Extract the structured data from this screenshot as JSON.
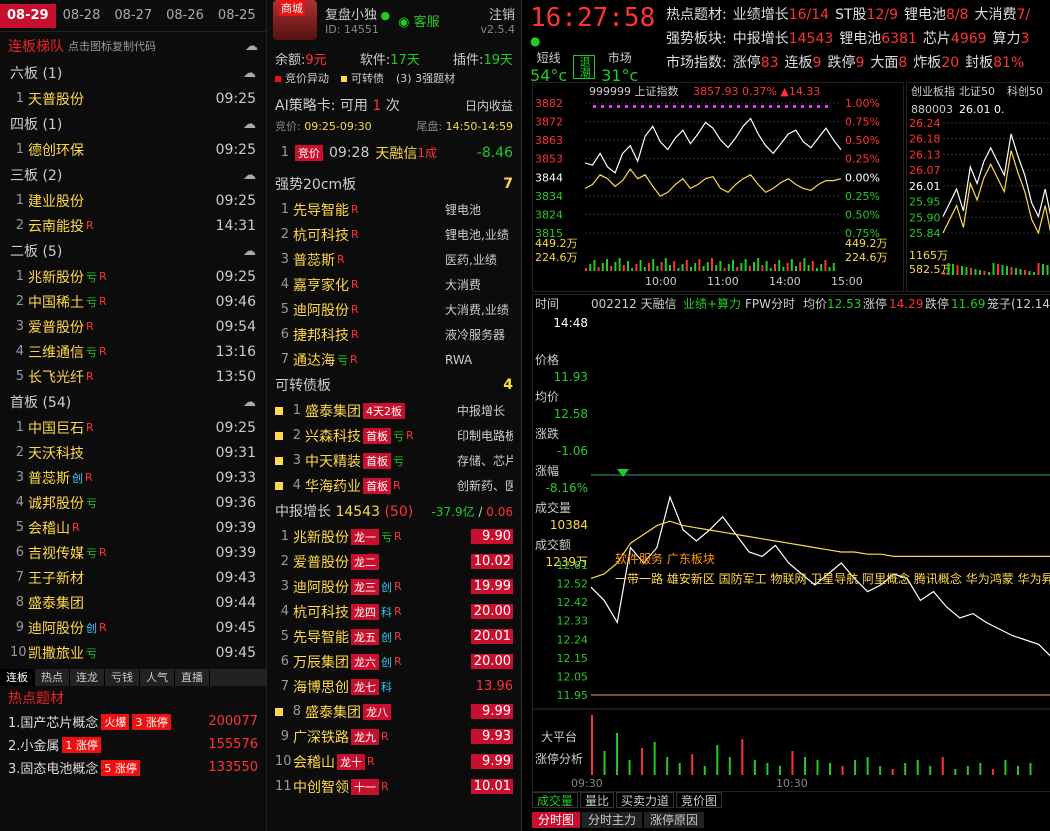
{
  "dates": [
    "08-29",
    "08-28",
    "08-27",
    "08-26",
    "08-25"
  ],
  "ladder": {
    "title": "连板梯队",
    "hint": "点击图标复制代码",
    "groups": [
      {
        "label": "六板 (1)",
        "items": [
          {
            "n": "1",
            "name": "天普股份",
            "tags": [],
            "time": "09:25"
          }
        ]
      },
      {
        "label": "四板 (1)",
        "items": [
          {
            "n": "1",
            "name": "德创环保",
            "tags": [],
            "time": "09:25"
          }
        ]
      },
      {
        "label": "三板 (2)",
        "items": [
          {
            "n": "1",
            "name": "建业股份",
            "tags": [],
            "time": "09:25"
          },
          {
            "n": "2",
            "name": "云南能投",
            "tags": [
              "R"
            ],
            "time": "14:31"
          }
        ]
      },
      {
        "label": "二板 (5)",
        "items": [
          {
            "n": "1",
            "name": "兆新股份",
            "tags": [
              "亏",
              "R"
            ],
            "time": "09:25"
          },
          {
            "n": "2",
            "name": "中国稀土",
            "tags": [
              "亏",
              "R"
            ],
            "time": "09:46"
          },
          {
            "n": "3",
            "name": "爱普股份",
            "tags": [
              "R"
            ],
            "time": "09:54"
          },
          {
            "n": "4",
            "name": "三维通信",
            "tags": [
              "亏",
              "R"
            ],
            "time": "13:16"
          },
          {
            "n": "5",
            "name": "长飞光纤",
            "tags": [
              "R"
            ],
            "time": "13:50"
          }
        ]
      },
      {
        "label": "首板 (54)",
        "items": [
          {
            "n": "1",
            "name": "中国巨石",
            "tags": [
              "R"
            ],
            "time": "09:25"
          },
          {
            "n": "2",
            "name": "天沃科技",
            "tags": [],
            "time": "09:31"
          },
          {
            "n": "3",
            "name": "普蕊斯",
            "tags": [
              "创",
              "R"
            ],
            "time": "09:33"
          },
          {
            "n": "4",
            "name": "诚邦股份",
            "tags": [
              "亏"
            ],
            "time": "09:36"
          },
          {
            "n": "5",
            "name": "会稽山",
            "tags": [
              "R"
            ],
            "time": "09:39"
          },
          {
            "n": "6",
            "name": "吉视传媒",
            "tags": [
              "亏",
              "R"
            ],
            "time": "09:39"
          },
          {
            "n": "7",
            "name": "王子新材",
            "tags": [],
            "time": "09:43"
          },
          {
            "n": "8",
            "name": "盛泰集团",
            "tags": [],
            "time": "09:44"
          },
          {
            "n": "9",
            "name": "迪阿股份",
            "tags": [
              "创",
              "R"
            ],
            "time": "09:45"
          },
          {
            "n": "10",
            "name": "凯撒旅业",
            "tags": [
              "亏"
            ],
            "time": "09:45"
          }
        ]
      }
    ]
  },
  "btabs": [
    "连板",
    "热点",
    "连龙",
    "亏钱",
    "人气",
    "直播"
  ],
  "hot": {
    "title": "热点题材",
    "items": [
      {
        "name": "1.国产芯片概念",
        "badges": [
          "火爆",
          "3 涨停"
        ],
        "v": "200077"
      },
      {
        "name": "2.小金属",
        "badges": [
          "1 涨停"
        ],
        "v": "155576"
      },
      {
        "name": "3.固态电池概念",
        "badges": [
          "5 涨停"
        ],
        "v": "133550"
      }
    ]
  },
  "user": {
    "shop": "商城",
    "name": "复盘小独",
    "id": "ID: 14551",
    "service": "客服",
    "logout": "注销",
    "ver": "v2.5.4"
  },
  "acct": {
    "yue": "余额:",
    "yue_v": "9元",
    "soft": "软件:",
    "soft_v": "17天",
    "plugin": "插件:",
    "plugin_v": "19天"
  },
  "legend": [
    "竞价异动",
    "可转债",
    "(3) 3强题材"
  ],
  "ai": {
    "title": "AI策略卡:",
    "avail": "可用",
    "cnt": "1",
    "unit": "次",
    "right": "日内收益",
    "bid": "竞价:",
    "bid_v": "09:25-09:30",
    "tail": "尾盘:",
    "tail_v": "14:50-14:59"
  },
  "airow": {
    "n": "1",
    "tag": "竞价",
    "time": "09:28",
    "name": "天融信",
    "suffix": "1成",
    "v": "-8.46"
  },
  "strong": {
    "title": "强势20cm板",
    "count": "7",
    "items": [
      {
        "n": "1",
        "name": "先导智能",
        "desc": "锂电池"
      },
      {
        "n": "2",
        "name": "杭可科技",
        "desc": "锂电池,业绩"
      },
      {
        "n": "3",
        "name": "普蕊斯",
        "desc": "医药,业绩"
      },
      {
        "n": "4",
        "name": "嘉亨家化",
        "desc": "大消费"
      },
      {
        "n": "5",
        "name": "迪阿股份",
        "desc": "大消费,业绩"
      },
      {
        "n": "6",
        "name": "捷邦科技",
        "desc": "液冷服务器"
      },
      {
        "n": "7",
        "name": "通达海",
        "desc": "RWA",
        "tag": "亏"
      }
    ]
  },
  "bond": {
    "title": "可转债板",
    "count": "4",
    "items": [
      {
        "n": "1",
        "name": "盛泰集团",
        "box": "4天2板",
        "desc": "中报增长"
      },
      {
        "n": "2",
        "name": "兴森科技",
        "box": "首板",
        "tags": "亏 R",
        "desc": "印制电路板"
      },
      {
        "n": "3",
        "name": "中天精装",
        "box": "首板",
        "tags": "亏",
        "desc": "存储、芯片"
      },
      {
        "n": "4",
        "name": "华海药业",
        "box": "首板",
        "tags": "R",
        "desc": "创新药、医"
      }
    ]
  },
  "growth": {
    "title": "中报增长",
    "num": "14543",
    "cnt": "(50)",
    "amt": "-37.9亿",
    "pct": "0.06",
    "items": [
      {
        "n": "1",
        "name": "兆新股份",
        "box": "龙一",
        "tags": "亏 R",
        "v": "9.90",
        "hl": true
      },
      {
        "n": "2",
        "name": "爱普股份",
        "box": "龙二",
        "tags": "",
        "v": "10.02",
        "hl": true
      },
      {
        "n": "3",
        "name": "迪阿股份",
        "box": "龙三",
        "tags": "创 R",
        "v": "19.99",
        "hl": true
      },
      {
        "n": "4",
        "name": "杭可科技",
        "box": "龙四",
        "tags": "科 R",
        "v": "20.00",
        "hl": true
      },
      {
        "n": "5",
        "name": "先导智能",
        "box": "龙五",
        "tags": "创 R",
        "v": "20.01",
        "hl": true
      },
      {
        "n": "6",
        "name": "万辰集团",
        "box": "龙六",
        "tags": "创 R",
        "v": "20.00",
        "hl": true
      },
      {
        "n": "7",
        "name": "海博思创",
        "box": "龙七",
        "tags": "科",
        "v": "13.96",
        "hl": false
      },
      {
        "n": "8",
        "name": "盛泰集团",
        "box": "龙八",
        "tags": "",
        "v": "9.99",
        "hl": true
      },
      {
        "n": "9",
        "name": "广深铁路",
        "box": "龙九",
        "tags": "R",
        "v": "9.93",
        "hl": true
      },
      {
        "n": "10",
        "name": "会稽山",
        "box": "龙十",
        "tags": "R",
        "v": "9.99",
        "hl": true
      },
      {
        "n": "11",
        "name": "中创智领",
        "box": "十一",
        "tags": "R",
        "v": "10.01",
        "hl": true
      }
    ]
  },
  "clock": {
    "time": "16:27:58",
    "l1": "短线",
    "l2": "退潮",
    "l3": "市场",
    "v1": "54°c",
    "v3": "31°c"
  },
  "stats": {
    "row1": [
      [
        "热点题材:",
        ""
      ],
      [
        "业绩增长",
        "16/14"
      ],
      [
        "ST股",
        "12/9"
      ],
      [
        "锂电池",
        "8/8"
      ],
      [
        "大消费",
        "7/"
      ]
    ],
    "row2": [
      [
        "强势板块:",
        ""
      ],
      [
        "中报增长",
        "14543"
      ],
      [
        "锂电池",
        "6381"
      ],
      [
        "芯片",
        "4969"
      ],
      [
        "算力",
        "3"
      ]
    ],
    "row3": [
      [
        "市场指数:",
        ""
      ],
      [
        "涨停",
        "83"
      ],
      [
        "连板",
        "9"
      ],
      [
        "跌停",
        "9"
      ],
      [
        "大面",
        "8"
      ],
      [
        "炸板",
        "20"
      ],
      [
        "封板",
        "81%"
      ]
    ]
  },
  "index": {
    "code": "999999",
    "name": "上证指数",
    "price": "3857.93",
    "pct": "0.37%",
    "chg": "▲14.33",
    "yl": [
      "3882",
      "3872",
      "3863",
      "3853",
      "3844",
      "3834",
      "3824",
      "3815"
    ],
    "yr": [
      "1.00%",
      "0.75%",
      "0.50%",
      "0.25%",
      "0.00%",
      "0.25%",
      "0.50%",
      "0.75%"
    ],
    "vol1": "449.2万",
    "vol2": "224.6万",
    "xt": [
      "10:00",
      "11:00",
      "14:00",
      "15:00"
    ]
  },
  "gem": {
    "tabs": [
      "创业板指",
      "北证50",
      "科创50"
    ],
    "code": "880003",
    "price": "26.01",
    "v": "0.",
    "yl": [
      "26.24",
      "26.18",
      "26.13",
      "26.07",
      "26.01",
      "25.95",
      "25.90",
      "25.84"
    ],
    "vol1": "1165万",
    "vol2": "582.5万"
  },
  "stock": {
    "tab": "时间",
    "code": "002212",
    "name": "天融信",
    "tags": "业绩+算力",
    "fpw": "FPW分时",
    "avg_l": "均价",
    "avg": "12.53",
    "zt_l": "涨停",
    "zt": "14.29",
    "dt_l": "跌停",
    "dt": "11.69",
    "lz": "笼子(12.14",
    "side": [
      [
        "14:48",
        ""
      ],
      [
        "价格",
        "11.93"
      ],
      [
        "均价",
        "12.58"
      ],
      [
        "涨跌",
        "-1.06"
      ],
      [
        "涨幅",
        "-8.16%"
      ],
      [
        "成交量",
        "10384"
      ],
      [
        "成交额",
        "1239万"
      ]
    ],
    "yl": [
      "12.61",
      "12.52",
      "12.42",
      "12.33",
      "12.24",
      "12.15",
      "12.05",
      "11.95"
    ],
    "notes1": "软件服务 广东板块",
    "notes2": "一带一路 雄安新区 国防军工 物联网 卫星导航 阿里概念 腾讯概念 华为鸿蒙 华为昇",
    "vlab": [
      "大平台",
      "涨停分析"
    ],
    "xt": [
      "09:30",
      "10:30"
    ],
    "ctabs": [
      "成交量",
      "量比",
      "买卖力道",
      "竞价图"
    ],
    "btabs": [
      "分时图",
      "分时主力",
      "涨停原因"
    ]
  },
  "colors": {
    "red": "#ff3333",
    "green": "#22cc22",
    "yellow": "#ffd84a"
  },
  "series": {
    "idx": [
      3851,
      3850,
      3856,
      3849,
      3846,
      3856,
      3860,
      3852,
      3865,
      3870,
      3862,
      3858,
      3864,
      3868,
      3861,
      3866,
      3872,
      3869,
      3863,
      3859,
      3864,
      3870,
      3874,
      3866,
      3860,
      3856,
      3861,
      3866,
      3868,
      3862,
      3859,
      3864,
      3869,
      3863,
      3858
    ],
    "idxavg": [
      3838,
      3840,
      3845,
      3843,
      3839,
      3842,
      3848,
      3843,
      3845,
      3839,
      3834,
      3836,
      3840,
      3843,
      3838,
      3840,
      3843,
      3844,
      3838,
      3836,
      3840,
      3843,
      3845,
      3840,
      3836,
      3838,
      3841,
      3843,
      3840,
      3838,
      3837,
      3840,
      3842,
      3842,
      3843
    ],
    "gem": [
      25.9,
      25.95,
      26.0,
      25.92,
      26.08,
      26.02,
      26.1,
      26.15,
      26.1,
      26.05,
      26.2,
      26.12,
      26.05,
      25.95,
      25.9,
      26.0,
      25.88
    ],
    "stk": [
      12.44,
      12.38,
      12.28,
      12.62,
      12.55,
      12.62,
      12.85,
      12.7,
      12.65,
      12.7,
      12.76,
      12.68,
      12.6,
      12.58,
      12.63,
      12.55,
      12.5,
      12.45,
      12.5,
      12.55,
      12.48,
      12.42,
      12.45,
      12.5,
      12.48,
      12.38,
      12.42,
      12.35,
      12.3,
      12.32,
      12.28,
      12.25,
      12.22,
      12.2,
      12.18,
      12.12
    ],
    "stkavg": [
      12.48,
      12.5,
      12.55,
      12.64,
      12.68,
      12.72,
      12.74,
      12.72,
      12.71,
      12.7,
      12.69,
      12.68,
      12.67,
      12.66,
      12.65,
      12.64,
      12.63,
      12.62,
      12.61,
      12.6,
      12.6,
      12.59,
      12.59,
      12.58,
      12.58,
      12.58,
      12.58,
      12.58,
      12.58,
      12.58,
      12.58,
      12.58,
      12.58,
      12.58,
      12.58,
      12.58
    ],
    "vols": [
      20,
      8,
      14,
      5,
      9,
      11,
      6,
      4,
      7,
      3,
      10,
      6,
      12,
      5,
      4,
      3,
      8,
      6,
      5,
      4,
      3,
      5,
      6,
      3,
      2,
      4,
      5,
      3,
      6,
      2,
      3,
      4,
      2,
      5,
      3,
      4
    ]
  }
}
